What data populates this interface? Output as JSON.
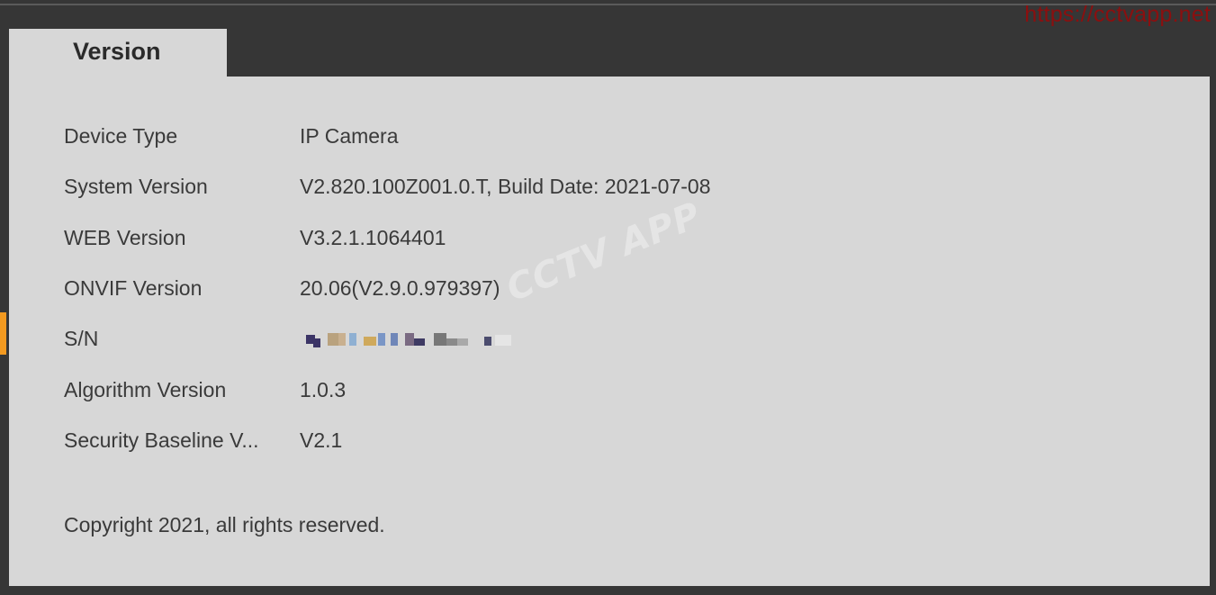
{
  "overlay": {
    "url_watermark": "https://cctvapp.net",
    "logo_watermark": "CCTV APP"
  },
  "tabs": [
    {
      "label": "Version"
    }
  ],
  "info": {
    "rows": [
      {
        "label": "Device Type",
        "value": "IP Camera"
      },
      {
        "label": "System Version",
        "value": "V2.820.100Z001.0.T, Build Date: 2021-07-08"
      },
      {
        "label": "WEB Version",
        "value": "V3.2.1.1064401"
      },
      {
        "label": "ONVIF Version",
        "value": "20.06(V2.9.0.979397)"
      },
      {
        "label": "S/N",
        "value": ""
      },
      {
        "label": "Algorithm Version",
        "value": "1.0.3"
      },
      {
        "label": "Security Baseline V...",
        "value": "V2.1"
      }
    ],
    "copyright": "Copyright 2021, all rights reserved."
  },
  "colors": {
    "background": "#363636",
    "panel": "#d7d7d7",
    "accent": "#f39a20",
    "watermark": "#8b0f0f"
  }
}
